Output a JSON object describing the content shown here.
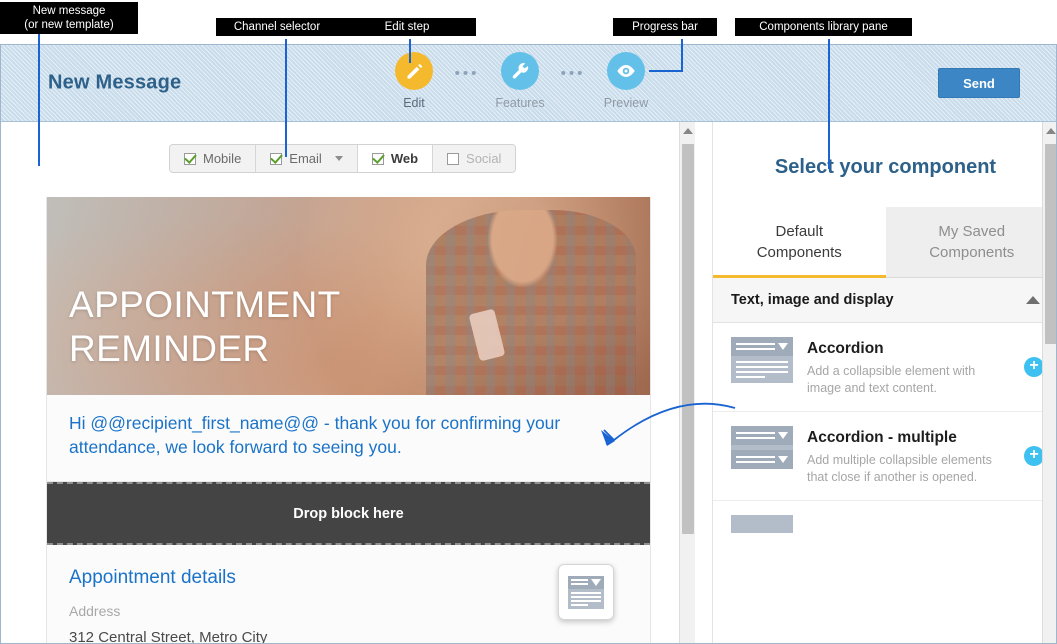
{
  "annotations": [
    {
      "name": "new-message",
      "text": "New message\n(or new template)"
    },
    {
      "name": "channel-selector",
      "text": "Channel selector"
    },
    {
      "name": "edit-step",
      "text": "Edit step"
    },
    {
      "name": "progress-bar",
      "text": "Progress bar"
    },
    {
      "name": "components-library",
      "text": "Components library pane"
    }
  ],
  "header": {
    "title": "New Message",
    "send_label": "Send",
    "separator": "•••",
    "steps": [
      {
        "label": "Edit",
        "icon": "pencil-icon",
        "state": "active",
        "color": "#f5b92e"
      },
      {
        "label": "Features",
        "icon": "wrench-icon",
        "state": "inactive",
        "color": "#63c0e8"
      },
      {
        "label": "Preview",
        "icon": "eye-icon",
        "state": "inactive",
        "color": "#63c0e8"
      }
    ]
  },
  "channels": [
    {
      "label": "Mobile",
      "checked": true,
      "selected": false,
      "dropdown": false,
      "disabled": false
    },
    {
      "label": "Email",
      "checked": true,
      "selected": false,
      "dropdown": true,
      "disabled": false
    },
    {
      "label": "Web",
      "checked": true,
      "selected": true,
      "dropdown": false,
      "disabled": false
    },
    {
      "label": "Social",
      "checked": false,
      "selected": false,
      "dropdown": false,
      "disabled": true
    }
  ],
  "email": {
    "hero_heading": "APPOINTMENT\nREMINDER",
    "greeting": "Hi @@recipient_first_name@@ - thank you for confirming your attendance, we look forward to seeing you.",
    "drop_zone_label": "Drop block here",
    "details_title": "Appointment details",
    "details_label": "Address",
    "details_value": "312 Central Street, Metro City"
  },
  "library": {
    "title": "Select your component",
    "tabs": [
      {
        "label": "Default\nComponents",
        "active": true
      },
      {
        "label": "My Saved\nComponents",
        "active": false
      }
    ],
    "section": {
      "title": "Text, image and display",
      "expanded": true
    },
    "components": [
      {
        "name": "Accordion",
        "description": "Add a collapsible element with image and text content.",
        "icon": "accordion-icon",
        "add_label": "+"
      },
      {
        "name": "Accordion - multiple",
        "description": "Add multiple collapsible elements that close if another is opened.",
        "icon": "accordion-multiple-icon",
        "add_label": "+"
      }
    ]
  },
  "colors": {
    "header_bg": "#c9dcec",
    "brand_blue": "#2d6189",
    "accent_yellow": "#f5b92e",
    "accent_cyan": "#3ec0f0",
    "link_blue": "#1a73c8",
    "send_blue": "#3c86c6",
    "annotation_line": "#1964d2"
  }
}
